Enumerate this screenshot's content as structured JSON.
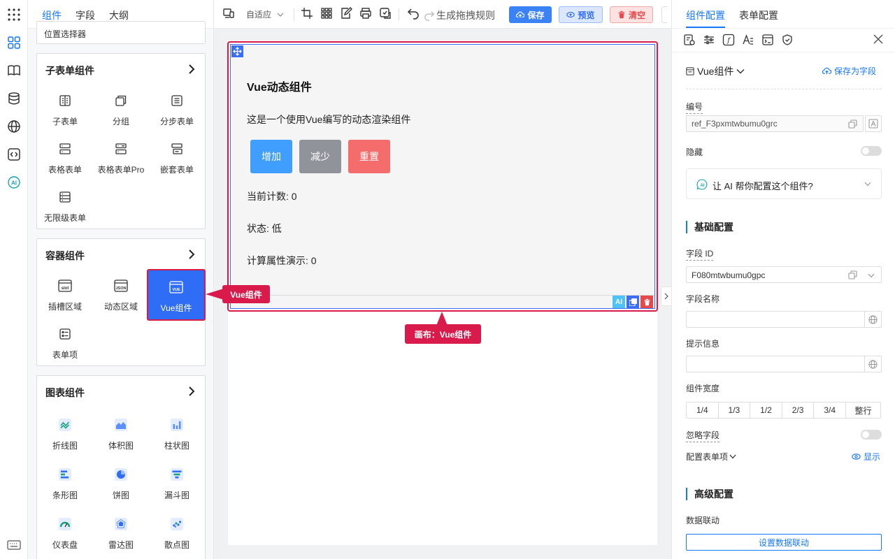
{
  "left_panel": {
    "tabs": [
      "组件",
      "字段",
      "大纲"
    ],
    "top_partial_item": "位置选择器",
    "sections": [
      {
        "title": "子表单组件",
        "items": [
          "子表单",
          "分组",
          "分步表单",
          "表格表单",
          "表格表单Pro",
          "嵌套表单",
          "无限级表单"
        ]
      },
      {
        "title": "容器组件",
        "items": [
          "插槽区域",
          "动态区域",
          "Vue组件",
          "表单项"
        ]
      },
      {
        "title": "图表组件",
        "items": [
          "折线图",
          "体积图",
          "柱状图",
          "条形图",
          "饼图",
          "漏斗图",
          "仪表盘",
          "雷达图",
          "散点图"
        ]
      }
    ],
    "icon_texts": {
      "slot": "slot",
      "json": "JSON",
      "vue": "VUE"
    }
  },
  "toolbar": {
    "layout_mode": "自适应",
    "rule_label": "生成拖拽规则",
    "save": "保存",
    "preview": "预览",
    "clear": "清空"
  },
  "canvas": {
    "component": {
      "title": "Vue动态组件",
      "description": "这是一个使用Vue编写的动态渲染组件",
      "buttons": [
        "增加",
        "减少",
        "重置"
      ],
      "count_line": "当前计数: 0",
      "status_line": "状态: 低",
      "computed_line": "计算属性演示: 0"
    },
    "callout_component": "Vue组件",
    "callout_canvas": "画布：Vue组件",
    "ai_tag": "AI"
  },
  "right_panel": {
    "tabs": [
      "组件配置",
      "表单配置"
    ],
    "component_type": "Vue组件",
    "save_as_field": "保存为字段",
    "id_label": "编号",
    "id_value": "ref_F3pxmtwbumu0grc",
    "hidden_label": "隐藏",
    "ai_prompt": "让 AI 帮你配置这个组件?",
    "basic_section": "基础配置",
    "field_id_label": "字段 ID",
    "field_id_value": "F080mtwbumu0gpc",
    "field_name_label": "字段名称",
    "hint_label": "提示信息",
    "width_label": "组件宽度",
    "width_options": [
      "1/4",
      "1/3",
      "1/2",
      "2/3",
      "3/4",
      "整行"
    ],
    "ignore_label": "忽略字段",
    "form_item_label": "配置表单项",
    "show_label": "显示",
    "advanced_section": "高级配置",
    "linkage_label": "数据联动",
    "linkage_button": "设置数据联动"
  },
  "colors": {
    "accent": "#1677ff",
    "selected": "#2f6df6",
    "highlight": "#d81b4a",
    "btn_add": "#409eff",
    "btn_sub": "#909399",
    "btn_reset": "#f56c6c"
  }
}
